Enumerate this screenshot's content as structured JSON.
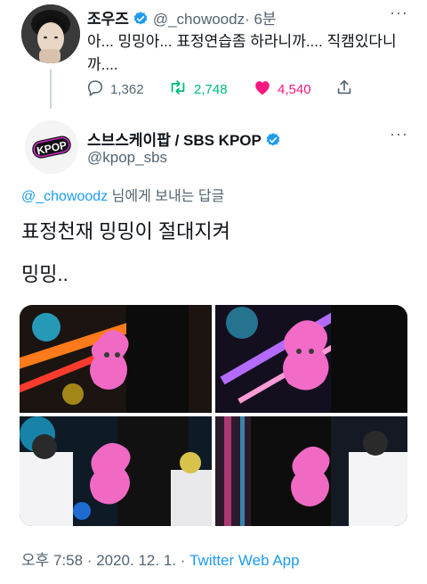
{
  "parent_tweet": {
    "display_name": "조우즈",
    "handle": "@_chowoodz",
    "time": "· 6분",
    "text_line1": "아... 밍밍아... 표정연습좀 하라니까.... 직캠있다니",
    "text_line2": "까....",
    "reply_count": "1,362",
    "retweet_count": "2,748",
    "like_count": "4,540"
  },
  "reply_tweet": {
    "display_name": "스브스케이팝 / SBS KPOP",
    "handle": "@kpop_sbs",
    "avatar_text": "KPOP",
    "replying_to_handle": "@_chowoodz",
    "replying_to_suffix": " 님에게 보내는 답글",
    "text_line1": "표정천재 밍밍이 절대지켜",
    "text_line2": "밍밍..",
    "timestamp": "오후 7:58 · 2020. 12. 1. · ",
    "source": "Twitter Web App"
  },
  "colors": {
    "accent": "#1d9bf0",
    "retweet": "#00ba7c",
    "like": "#f91880",
    "muted": "#536471"
  }
}
